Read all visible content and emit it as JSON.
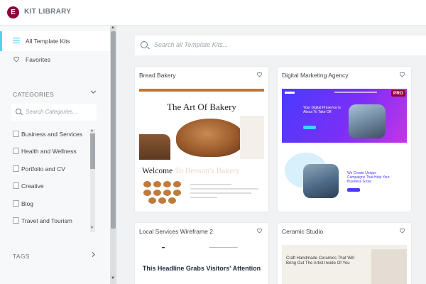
{
  "app": {
    "logo_letter": "E",
    "title": "KIT LIBRARY"
  },
  "sidebar": {
    "nav": [
      {
        "label": "All Template Kits",
        "icon": "menu-lines-icon",
        "active": true
      },
      {
        "label": "Favorites",
        "icon": "heart-icon",
        "active": false
      }
    ],
    "categories_title": "CATEGORIES",
    "category_search_placeholder": "Search Categories...",
    "categories": [
      "Business and Services",
      "Health and Wellness",
      "Portfolio and CV",
      "Creative",
      "Blog",
      "Travel and Tourism"
    ],
    "tags_title": "TAGS"
  },
  "main": {
    "search_placeholder": "Search all Template Kits...",
    "kits": [
      {
        "title": "Bread Bakery",
        "pro": false,
        "preview": {
          "heading": "The Art Of Bakery",
          "welcome_a": "Welcome ",
          "welcome_b": "To Benson's Bakery"
        }
      },
      {
        "title": "Digital Marketing Agency",
        "pro": true,
        "badge": "PRO",
        "preview": {
          "hero": "Your Digital Presence is About To Take Off",
          "section": "We Create Unique Campaigns That Help Your Business Grow"
        }
      },
      {
        "title": "Local Services Wireframe 2",
        "pro": false,
        "preview": {
          "heading": "This Headline Grabs Visitors' Attention"
        }
      },
      {
        "title": "Ceramic Studio",
        "pro": false,
        "preview": {
          "heading": "Craft Handmade Ceramics That Will Bring Out The Artist Inside Of You"
        }
      }
    ]
  },
  "colors": {
    "brand": "#92003b",
    "accent": "#58d0f5",
    "bakery": "#c9742d",
    "marketing": "#4a3aff"
  }
}
